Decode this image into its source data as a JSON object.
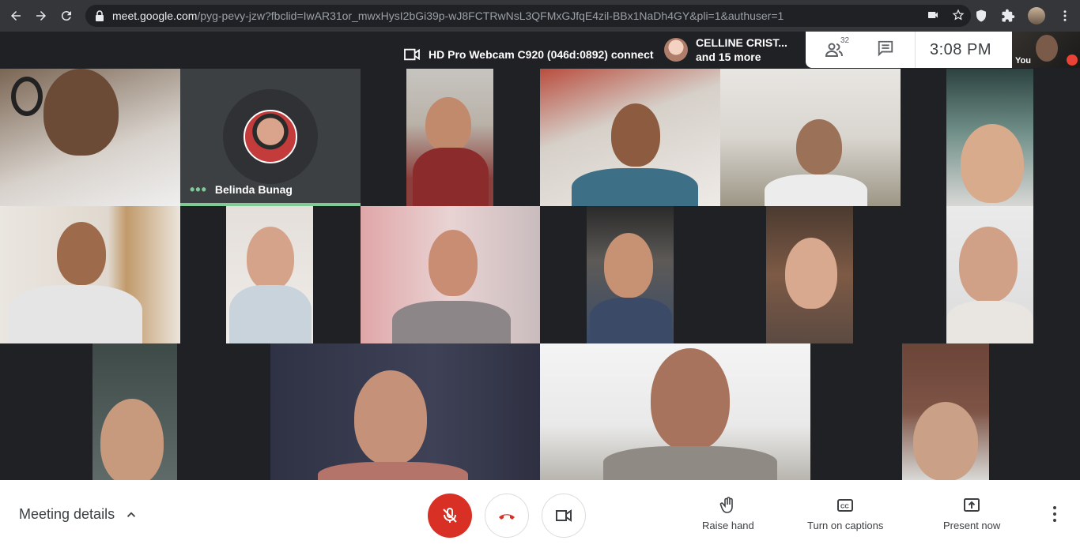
{
  "browser": {
    "url_host": "meet.google.com",
    "url_path": "/pyg-pevy-jzw?fbclid=IwAR31or_mwxHysI2bGi39p-wJ8FCTRwNsL3QFMxGJfqE4zil-BBx1NaDh4GY&pli=1&authuser=1"
  },
  "banner": {
    "camera_text": "HD Pro Webcam C920 (046d:0892)  connect"
  },
  "presenting": {
    "name": "CELLINE CRIST...",
    "more": "and 15 more"
  },
  "info_bar": {
    "participant_count": "32",
    "time": "3:08  PM"
  },
  "self_view": {
    "label": "You"
  },
  "speaking_tile": {
    "name": "Belinda Bunag",
    "indicator": "•••"
  },
  "controls": {
    "meeting_details": "Meeting details",
    "raise_hand": "Raise hand",
    "captions": "Turn on captions",
    "present": "Present now"
  },
  "colors": {
    "speaking": "#81c995",
    "mic_off": "#d93025",
    "hangup_icon": "#d93025"
  }
}
